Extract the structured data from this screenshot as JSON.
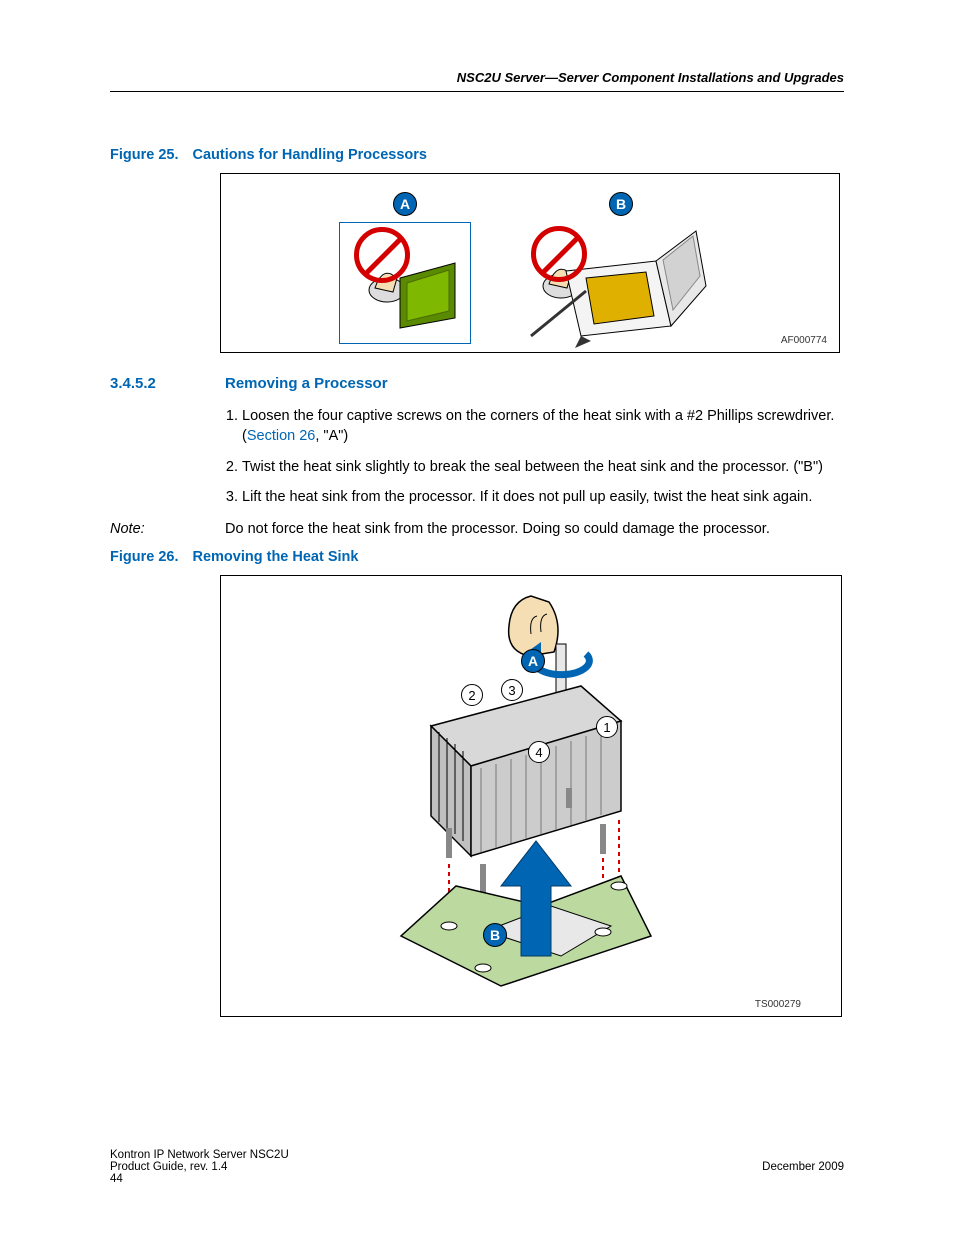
{
  "header": "NSC2U Server—Server Component Installations and Upgrades",
  "figure25": {
    "label": "Figure 25.",
    "title": "Cautions for Handling Processors",
    "callouts": {
      "a": "A",
      "b": "B"
    },
    "image_ref": "AF000774"
  },
  "section": {
    "number": "3.4.5.2",
    "title": "Removing a Processor"
  },
  "steps": {
    "s1a": "Loosen the four captive screws on the corners of the heat sink with a #2 Phillips screwdriver. (",
    "s1link": "Section 26",
    "s1b": ", \"A\")",
    "s2": "Twist the heat sink slightly to break the seal between the heat sink and the processor. (\"B\")",
    "s3": "Lift the heat sink from the processor. If it does not pull up easily, twist the heat sink again."
  },
  "note": {
    "label": "Note:",
    "text": "Do not force the heat sink from the processor. Doing so could damage the processor."
  },
  "figure26": {
    "label": "Figure 26.",
    "title": "Removing the Heat Sink",
    "callouts": {
      "a": "A",
      "b": "B",
      "n1": "1",
      "n2": "2",
      "n3": "3",
      "n4": "4"
    },
    "image_ref": "TS000279"
  },
  "footer": {
    "left1": "Kontron IP Network Server NSC2U",
    "left2": "Product Guide, rev. 1.4",
    "left3": "44",
    "right": "December 2009"
  }
}
